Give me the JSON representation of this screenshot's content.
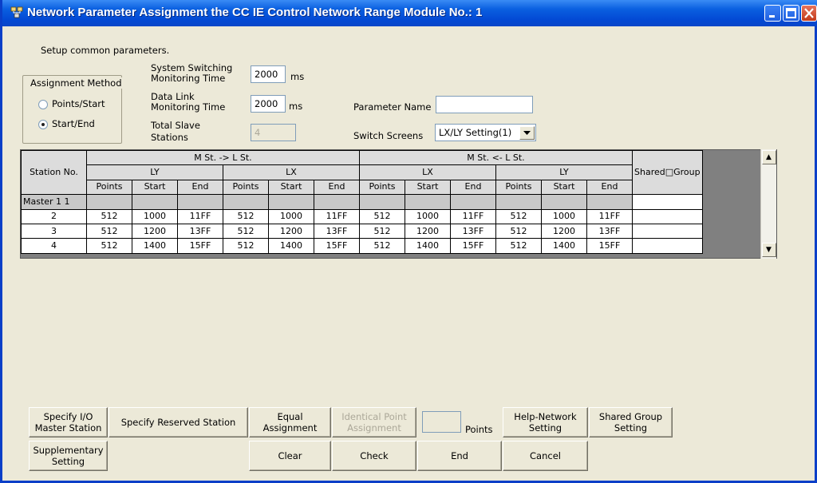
{
  "window": {
    "title": "Network Parameter  Assignment the CC IE Control Network Range Module No.: 1",
    "controls": [
      "minimize-icon",
      "maximize-icon",
      "close-icon"
    ]
  },
  "form": {
    "setup_text": "Setup common parameters.",
    "assignment_method": {
      "legend": "Assignment Method",
      "options": [
        "Points/Start",
        "Start/End"
      ],
      "selected": "Start/End"
    },
    "system_switching": {
      "label_1": "System Switching",
      "label_2": "Monitoring Time",
      "value": "2000",
      "unit": "ms"
    },
    "data_link": {
      "label_1": "Data Link",
      "label_2": "Monitoring Time",
      "value": "2000",
      "unit": "ms"
    },
    "total_slave": {
      "label_1": "Total Slave",
      "label_2": "Stations",
      "value": "4"
    },
    "parameter_name": {
      "label": "Parameter Name",
      "value": ""
    },
    "switch_screens": {
      "label": "Switch Screens",
      "value": "LX/LY Setting(1)"
    }
  },
  "grid": {
    "station_header": "Station No.",
    "group_m_to_l": "M St. -> L St.",
    "group_l_to_m": "M St. <- L St.",
    "sub_ly_1": "LY",
    "sub_lx_1": "LX",
    "sub_lx_2": "LX",
    "sub_ly_2": "LY",
    "shared_group": "Shared□Group",
    "cols": [
      "Points",
      "Start",
      "End",
      "Points",
      "Start",
      "End",
      "Points",
      "Start",
      "End",
      "Points",
      "Start",
      "End"
    ],
    "rows": [
      {
        "station": "Master 1    1",
        "cells": [
          "",
          "",
          "",
          "",
          "",
          "",
          "",
          "",
          "",
          "",
          "",
          ""
        ]
      },
      {
        "station": "2",
        "cells": [
          "512",
          "1000",
          "11FF",
          "512",
          "1000",
          "11FF",
          "512",
          "1000",
          "11FF",
          "512",
          "1000",
          "11FF"
        ]
      },
      {
        "station": "3",
        "cells": [
          "512",
          "1200",
          "13FF",
          "512",
          "1200",
          "13FF",
          "512",
          "1200",
          "13FF",
          "512",
          "1200",
          "13FF"
        ]
      },
      {
        "station": "4",
        "cells": [
          "512",
          "1400",
          "15FF",
          "512",
          "1400",
          "15FF",
          "512",
          "1400",
          "15FF",
          "512",
          "1400",
          "15FF"
        ]
      }
    ]
  },
  "buttons": {
    "specify_io_1": "Specify I/O",
    "specify_io_2": "Master Station",
    "specify_reserved": "Specify Reserved Station",
    "equal_1": "Equal",
    "equal_2": "Assignment",
    "identical_1": "Identical Point",
    "identical_2": "Assignment",
    "points_label": "Points",
    "points_value": "",
    "help_1": "Help-Network",
    "help_2": "Setting",
    "shared_1": "Shared Group",
    "shared_2": "Setting",
    "supp_1": "Supplementary",
    "supp_2": "Setting",
    "clear": "Clear",
    "check": "Check",
    "end": "End",
    "cancel": "Cancel"
  }
}
